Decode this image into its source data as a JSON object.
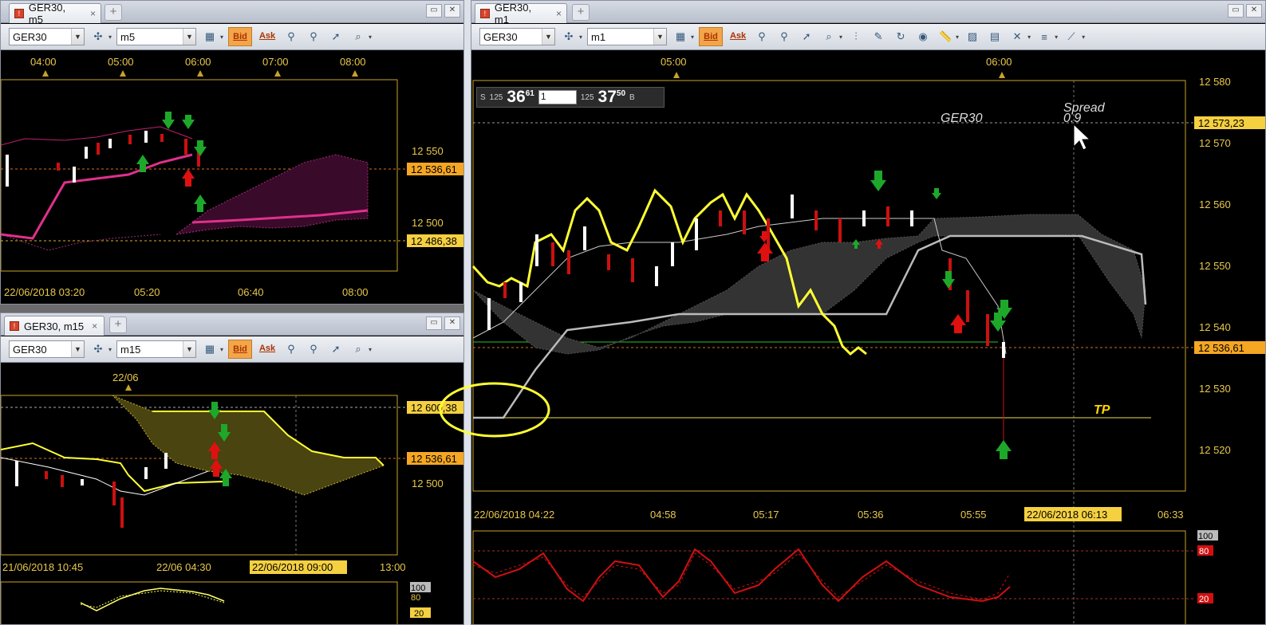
{
  "ui": {
    "tab_close": "×",
    "new_tab": "+",
    "combo_arrow": "▼",
    "tb_caret": "▾",
    "minimize": "▭",
    "close": "✕",
    "bid": "Bid",
    "ask": "Ask"
  },
  "win_m5": {
    "tab": "GER30, m5",
    "symbol": "GER30",
    "timeframe": "m5",
    "top_times": [
      "04:00",
      "05:00",
      "06:00",
      "07:00",
      "08:00"
    ],
    "bottom_times": [
      "22/06/2018 03:20",
      "05:20",
      "06:40",
      "08:00"
    ],
    "price_ticks": [
      "12 550",
      "12 500"
    ],
    "price_labels": [
      "12 536,61",
      "12 486,38"
    ]
  },
  "win_m15": {
    "tab": "GER30, m15",
    "symbol": "GER30",
    "timeframe": "m15",
    "top_times": [
      "22/06"
    ],
    "bottom_times": [
      "21/06/2018 10:45",
      "22/06 04:30",
      "22/06/2018 09:00",
      "13:00"
    ],
    "price_ticks": [
      "12 500"
    ],
    "price_labels": [
      "12 600,38",
      "12 536,61"
    ],
    "osc_ticks": [
      "100",
      "80",
      "20"
    ]
  },
  "win_m1": {
    "tab": "GER30, m1",
    "symbol": "GER30",
    "timeframe": "m1",
    "top_times": [
      "05:00",
      "06:00"
    ],
    "bottom_times": [
      "22/06/2018 04:22",
      "04:58",
      "05:17",
      "05:36",
      "05:55",
      "22/06/2018 06:13",
      "06:33"
    ],
    "price_ticks": [
      "12 580",
      "12 570",
      "12 560",
      "12 550",
      "12 540",
      "12 530",
      "12 520"
    ],
    "price_labels": [
      "12 573,23",
      "12 536,61"
    ],
    "osc_ticks": [
      "100",
      "80",
      "20"
    ],
    "watermark": "GER30",
    "spread_label": "Spread",
    "spread_value": "0.9",
    "tp_label": "TP",
    "quote": {
      "sell_tag": "S",
      "sell_prefix": "125",
      "sell_big": "36",
      "sell_sup": "61",
      "lot": "1",
      "buy_prefix": "125",
      "buy_big": "37",
      "buy_sup": "50",
      "buy_tag": "B"
    }
  },
  "colors": {
    "grid_gold": "#c9a227",
    "price_label_bg": "#f5a623",
    "ichimoku_cloud_dark": "#3a3a3a",
    "pink_line": "#e0308c",
    "yellow_line": "#ffff33",
    "bull_candle": "#ffffff",
    "bear_candle": "#cc1010",
    "stoch_red": "#d01010",
    "arrow_green": "#1ea82a",
    "arrow_red": "#e01010"
  }
}
